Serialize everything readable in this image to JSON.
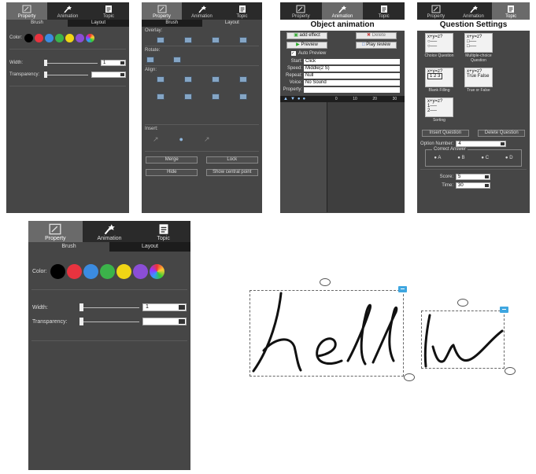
{
  "tabs": {
    "property": "Property",
    "animation": "Animation",
    "topic": "Topic"
  },
  "subtabs": {
    "brush": "Brush",
    "layout": "Layout"
  },
  "brush_panel": {
    "color_label": "Color:",
    "width_label": "Width:",
    "width_value": "1",
    "transparency_label": "Transparency:",
    "colors": [
      "#000000",
      "#e8333f",
      "#3b8be0",
      "#3bb34a",
      "#f1d515",
      "#8b4ed6",
      "rainbow"
    ]
  },
  "layout_panel": {
    "overlay_label": "Overlay:",
    "rotate_label": "Rotate:",
    "align_label": "Align:",
    "insert_label": "Insert:",
    "merge": "Merge",
    "lock": "Lock",
    "hide": "Hide",
    "show_central_point": "Show central point"
  },
  "animation_panel": {
    "title": "Object animation",
    "add_effect": "add effect",
    "delete": "Delete",
    "preview": "Preview",
    "play_review": "Play review",
    "auto_preview": "Auto Preview",
    "fields": [
      {
        "label": "Start:",
        "value": "Click"
      },
      {
        "label": "Speed:",
        "value": "Middle(2 S)"
      },
      {
        "label": "Repeat:",
        "value": "Null"
      },
      {
        "label": "Voice:",
        "value": "No Sound"
      },
      {
        "label": "Property:",
        "value": ""
      }
    ],
    "timeline_ticks": [
      "0",
      "10",
      "20",
      "30"
    ]
  },
  "question_panel": {
    "title": "Question Settings",
    "cards": [
      {
        "top": "x+y=z?",
        "caption": "Choice Question"
      },
      {
        "top": "x+y=z?",
        "caption": "Multiple-choice Question"
      },
      {
        "top": "x+y=z?",
        "caption": "Blank Filling",
        "extra": "1 2 3"
      },
      {
        "top": "x+y=z?",
        "caption": "True or False",
        "extra": "True False"
      },
      {
        "top": "x+y=z?",
        "caption": "Sorting"
      }
    ],
    "insert_question": "Insert Question",
    "delete_question": "Delete Question",
    "option_number_label": "Option Number:",
    "option_number_value": "4",
    "correct_answer_label": "Correct Answer",
    "options": [
      "A",
      "B",
      "C",
      "D"
    ],
    "score_label": "Score:",
    "score_value": "5",
    "time_label": "Time:",
    "time_value": "30"
  },
  "canvas": {
    "word1": "hell",
    "word2": "lw"
  }
}
